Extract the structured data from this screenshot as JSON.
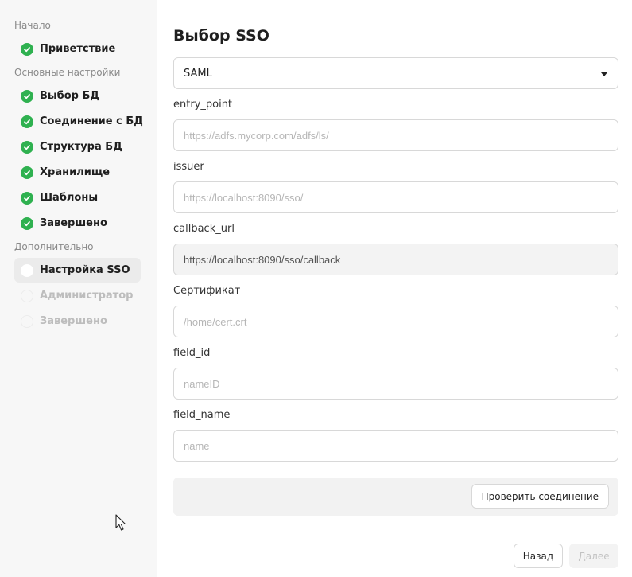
{
  "sidebar": {
    "sections": [
      {
        "title": "Начало"
      },
      {
        "title": "Основные настройки"
      },
      {
        "title": "Дополнительно"
      }
    ],
    "steps": [
      {
        "label": "Приветствие",
        "status": "done",
        "icon": "check-icon"
      },
      {
        "label": "Выбор БД",
        "status": "done",
        "icon": "check-icon"
      },
      {
        "label": "Соединение с БД",
        "status": "done",
        "icon": "check-icon"
      },
      {
        "label": "Структура БД",
        "status": "done",
        "icon": "check-icon"
      },
      {
        "label": "Хранилище",
        "status": "done",
        "icon": "check-icon"
      },
      {
        "label": "Шаблоны",
        "status": "done",
        "icon": "check-icon"
      },
      {
        "label": "Завершено",
        "status": "done",
        "icon": "check-icon"
      },
      {
        "label": "Настройка SSO",
        "status": "current",
        "icon": "circle-icon"
      },
      {
        "label": "Администратор",
        "status": "pending",
        "icon": "circle-icon"
      },
      {
        "label": "Завершено",
        "status": "pending",
        "icon": "circle-icon"
      }
    ]
  },
  "main": {
    "title": "Выбор SSO",
    "sso_type": {
      "value": "SAML",
      "icon": "chevron-down-icon"
    },
    "fields": [
      {
        "label": "entry_point",
        "value": "",
        "placeholder": "https://adfs.mycorp.com/adfs/ls/",
        "readonly": false
      },
      {
        "label": "issuer",
        "value": "",
        "placeholder": "https://localhost:8090/sso/",
        "readonly": false
      },
      {
        "label": "callback_url",
        "value": "https://localhost:8090/sso/callback",
        "placeholder": "",
        "readonly": true
      },
      {
        "label": "Сертификат",
        "value": "",
        "placeholder": "/home/cert.crt",
        "readonly": false
      },
      {
        "label": "field_id",
        "value": "",
        "placeholder": "nameID",
        "readonly": false
      },
      {
        "label": "field_name",
        "value": "",
        "placeholder": "name",
        "readonly": false
      }
    ],
    "check_connection_label": "Проверить соединение"
  },
  "footer": {
    "back_label": "Назад",
    "next_label": "Далее"
  },
  "colors": {
    "done": "#2fb150",
    "active_bg": "#ebebeb",
    "disabled_text": "#c2c2c2"
  }
}
